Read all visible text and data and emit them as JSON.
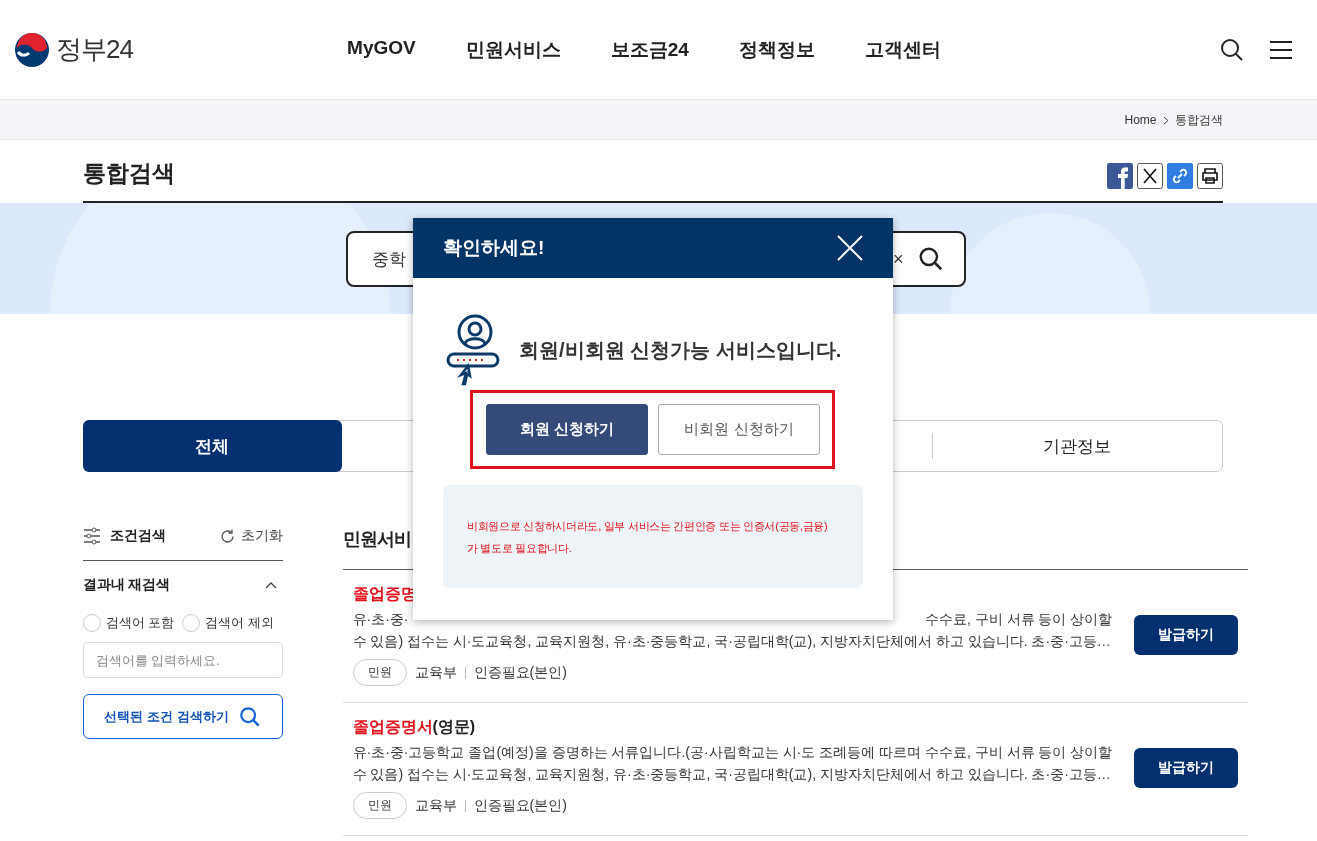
{
  "header": {
    "logo": "정부24",
    "nav": [
      "MyGOV",
      "민원서비스",
      "보조금24",
      "정책정보",
      "고객센터"
    ]
  },
  "breadcrumb": [
    "Home",
    "통합검색"
  ],
  "page_title": "통합검색",
  "search": {
    "value": "중학",
    "clear": "×"
  },
  "tabs": [
    {
      "label": "전체",
      "selected": true
    },
    {
      "label": "기관정보",
      "selected": false
    }
  ],
  "sidebar": {
    "title": "조건검색",
    "reset": "초기화",
    "section": {
      "title": "결과내 재검색",
      "expanded": true
    },
    "options": [
      {
        "label": "검색어 포함",
        "selected": false
      },
      {
        "label": "검색어 제외",
        "selected": false
      }
    ],
    "placeholder": "검색어를 입력하세요.",
    "button": "선택된 조건 검색하기"
  },
  "results": {
    "heading": "민원서비",
    "rows": [
      {
        "title": "졸업증명",
        "suffix": "",
        "line1_left": "유·초·중·",
        "line1_right": "수수료, 구비 서류 등이 상이할",
        "line2": "수 있음) 접수는 시·도교육청, 교육지원청, 유·초·중등학교, 국·공립대학(교), 지방자치단체에서 하고 있습니다. 초·중·고등…",
        "tag": "민원",
        "org": "교육부",
        "auth": "인증필요(본인)",
        "button": "발급하기"
      },
      {
        "title": "졸업증명서",
        "suffix": "(영문)",
        "line1_left": "유·초·중·고등학교 졸업(예정)을 증명하는 서류입니다.(공·사립학교는 시·도 조례등에 따르며 수수료, 구비 서류 등이 상이할",
        "line1_right": "",
        "line2": "수 있음) 접수는 시·도교육청, 교육지원청, 유·초·중등학교, 국·공립대학(교), 지방자치단체에서 하고 있습니다. 초·중·고등…",
        "tag": "민원",
        "org": "교육부",
        "auth": "인증필요(본인)",
        "button": "발급하기"
      }
    ]
  },
  "modal": {
    "title": "확인하세요!",
    "message": "회원/비회원 신청가능 서비스입니다.",
    "buttons": [
      {
        "label": "회원 신청하기",
        "selected": true
      },
      {
        "label": "비회원 신청하기",
        "selected": false
      }
    ],
    "notice": [
      "비회원으로 신청하시더라도, 일부 서비스는 간편인증 또는 인증서(공동,금융)",
      "가 별도로 필요합니다."
    ]
  }
}
